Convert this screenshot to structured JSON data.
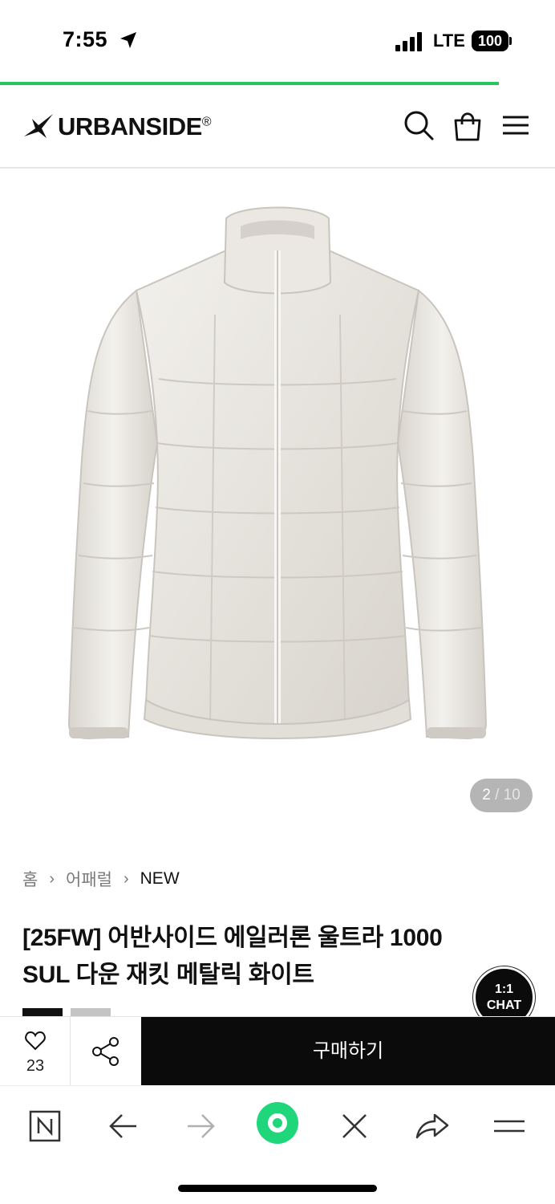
{
  "status_bar": {
    "time": "7:55",
    "network": "LTE",
    "battery": "100"
  },
  "header": {
    "logo_text": "URBANSIDE",
    "logo_mark": "®",
    "icons": [
      "search-icon",
      "shopping-bag-icon",
      "menu-icon"
    ]
  },
  "gallery": {
    "current": "2",
    "separator": " / ",
    "total": "10"
  },
  "breadcrumb": {
    "items": [
      "홈",
      "어패럴",
      "NEW"
    ],
    "separator": "›"
  },
  "product": {
    "title_line1": "[25FW] 어반사이드 에일러론 울트라 1000",
    "title_line2": "SUL 다운 재킷 메탈릭 화이트"
  },
  "chat": {
    "line1": "1:1",
    "line2": "CHAT"
  },
  "actions": {
    "like_count": "23",
    "buy_label": "구매하기"
  },
  "browser_toolbar": {
    "items": [
      "naver-n-icon",
      "back-arrow-icon",
      "forward-arrow-icon",
      "green-circle-home-icon",
      "close-icon",
      "share-arrow-icon",
      "menu-icon"
    ]
  },
  "colors": {
    "accent_green": "#22c55e",
    "buy_bg": "#0b0b0b",
    "counter_bg": "#b5b5b5"
  }
}
